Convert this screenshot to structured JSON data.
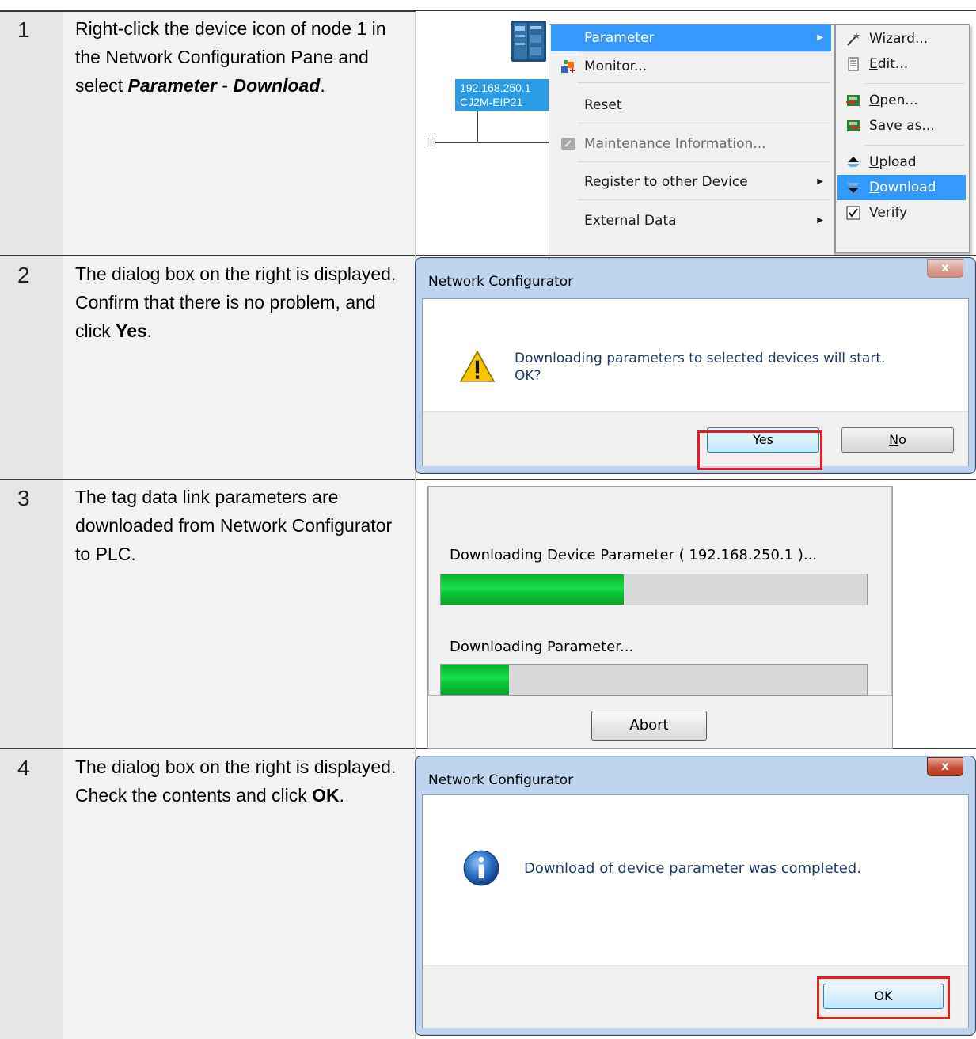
{
  "steps": [
    {
      "number": "1",
      "text_a": "Right-click the device icon of node 1 in the Network Configuration Pane and select ",
      "text_b": "Parameter",
      "text_c": " - ",
      "text_d": "Download",
      "text_e": "."
    },
    {
      "number": "2",
      "text_a": "The dialog box on the right is displayed. Confirm that there is no problem, and click ",
      "text_b": "Yes",
      "text_c": "."
    },
    {
      "number": "3",
      "text_a": "The tag data link parameters are downloaded from Network Configurator to PLC."
    },
    {
      "number": "4",
      "text_a": "The dialog box on the right is displayed. Check the contents and click ",
      "text_b": "OK",
      "text_c": "."
    }
  ],
  "node": {
    "ip": "192.168.250.1",
    "model": "CJ2M-EIP21"
  },
  "context_menu": {
    "items": [
      "Parameter",
      "Monitor...",
      "Reset",
      "Maintenance Information...",
      "Register to other Device",
      "External Data"
    ],
    "highlighted": "Parameter"
  },
  "submenu": {
    "items": [
      "Wizard...",
      "Edit...",
      "Open...",
      "Save as...",
      "Upload",
      "Download",
      "Verify"
    ],
    "highlighted": "Download"
  },
  "dialog_confirm": {
    "title": "Network Configurator",
    "message_line1": "Downloading parameters to selected devices will start.",
    "message_line2": "OK?",
    "yes_label": "Yes",
    "no_label": "No",
    "close_glyph": "x"
  },
  "progress_dialog": {
    "line1": "Downloading Device Parameter ( 192.168.250.1 )...",
    "line1_progress": 0.43,
    "line2": "Downloading Parameter...",
    "line2_progress": 0.16,
    "abort_label": "Abort"
  },
  "dialog_done": {
    "title": "Network Configurator",
    "message": "Download of device parameter was completed.",
    "ok_label": "OK",
    "close_glyph": "x"
  },
  "colors": {
    "highlight": "#3399ff",
    "progress_green": "#19e04a",
    "callout_red": "#e02020"
  }
}
